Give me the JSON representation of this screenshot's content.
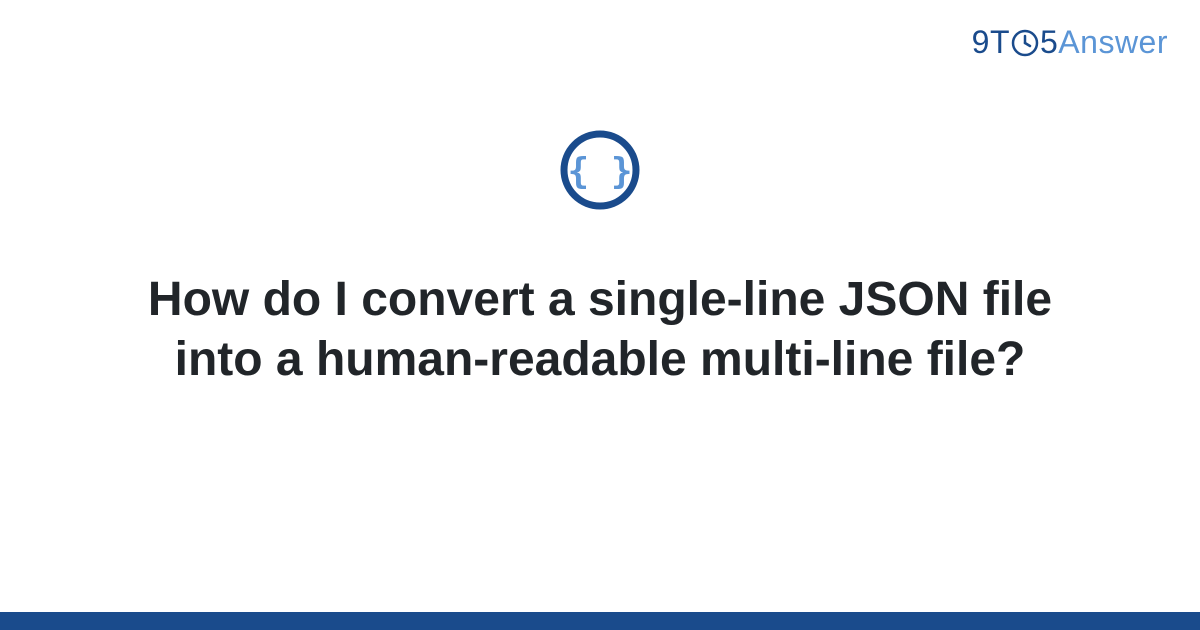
{
  "brand": {
    "part1": "9T",
    "part2": "5",
    "part3": "Answer"
  },
  "topic": {
    "icon_name": "json-braces-icon"
  },
  "question": {
    "title": "How do I convert a single-line JSON file into a human-readable multi-line file?"
  },
  "colors": {
    "brand_dark": "#1a4b8c",
    "brand_light": "#5b95d6",
    "text": "#212529"
  }
}
